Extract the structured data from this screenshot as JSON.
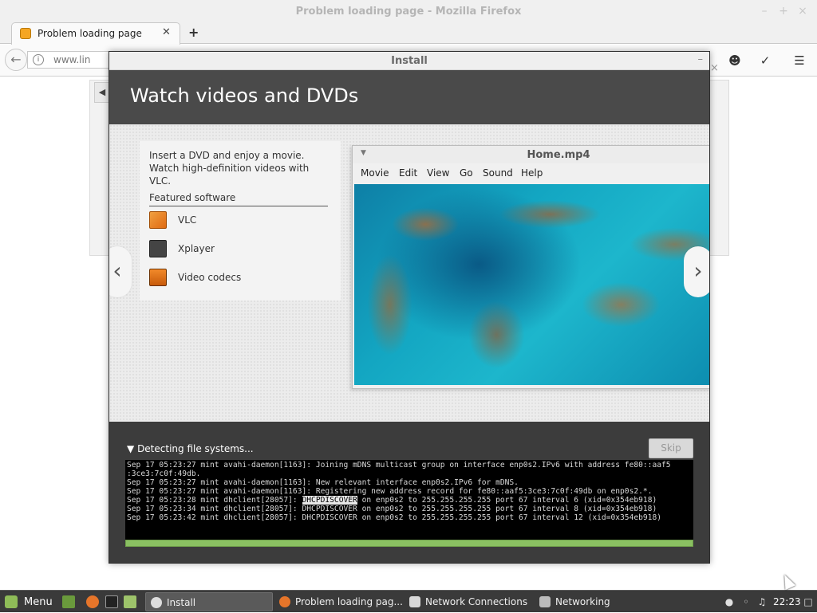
{
  "firefox": {
    "window_title": "Problem loading page - Mozilla Firefox",
    "tab_label": "Problem loading page",
    "tab_close": "✕",
    "new_tab": "+",
    "url": "www.lin",
    "window_buttons": [
      "–",
      "+",
      "×"
    ]
  },
  "installer": {
    "window_title": "Install",
    "minimize": "–",
    "heading": "Watch videos and DVDs",
    "slide": {
      "description": "Insert a DVD and enjoy a movie. Watch high-definition videos with VLC.",
      "featured_heading": "Featured software",
      "software": [
        {
          "label": "VLC",
          "icon": "vlc-icon"
        },
        {
          "label": "Xplayer",
          "icon": "xplayer-icon"
        },
        {
          "label": "Video codecs",
          "icon": "video-codecs-icon"
        }
      ],
      "prev": "‹",
      "next": "›",
      "player": {
        "title": "Home.mp4",
        "menus": [
          "Movie",
          "Edit",
          "View",
          "Go",
          "Sound",
          "Help"
        ]
      }
    },
    "status": "Detecting file systems...",
    "skip_label": "Skip",
    "log_lines": [
      "Sep 17 05:23:27 mint avahi-daemon[1163]: Joining mDNS multicast group on interface enp0s2.IPv6 with address fe80::aaf5",
      ":3ce3:7c0f:49db.",
      "Sep 17 05:23:27 mint avahi-daemon[1163]: New relevant interface enp0s2.IPv6 for mDNS.",
      "Sep 17 05:23:27 mint avahi-daemon[1163]: Registering new address record for fe80::aaf5:3ce3:7c0f:49db on enp0s2.*.",
      "Sep 17 05:23:28 mint dhclient[28057]: |DHCPDISCOVER| on enp0s2 to 255.255.255.255 port 67 interval 6 (xid=0x354eb918)",
      "Sep 17 05:23:34 mint dhclient[28057]: DHCPDISCOVER on enp0s2 to 255.255.255.255 port 67 interval 8 (xid=0x354eb918)",
      "Sep 17 05:23:42 mint dhclient[28057]: DHCPDISCOVER on enp0s2 to 255.255.255.255 port 67 interval 12 (xid=0x354eb918)"
    ],
    "progress": 1.0
  },
  "taskbar": {
    "menu_label": "Menu",
    "tasks": [
      {
        "label": "Install",
        "icon": "install-icon"
      },
      {
        "label": "Problem loading pag...",
        "icon": "firefox-icon"
      },
      {
        "label": "Network Connections",
        "icon": "network-connections-icon"
      },
      {
        "label": "Networking",
        "icon": "networking-icon"
      }
    ],
    "clock": "22:23"
  },
  "colors": {
    "installer_header": "#4a4a4a",
    "progress": "#8ac062",
    "taskbar": "#3a3a3a",
    "mint_green": "#8fbc58"
  }
}
